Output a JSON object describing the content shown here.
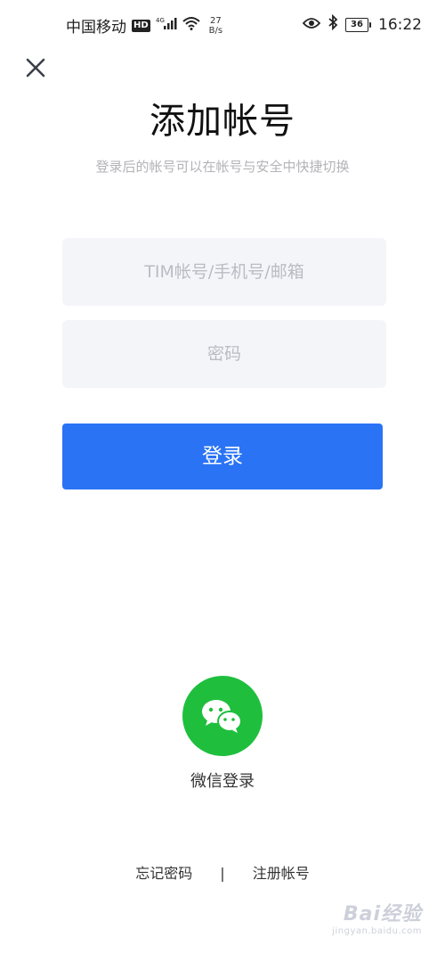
{
  "status_bar": {
    "carrier": "中国移动",
    "hd_badge": "HD",
    "network": "4G",
    "speed_value": "27",
    "speed_unit": "B/s",
    "battery": "36",
    "time": "16:22"
  },
  "header": {
    "title": "添加帐号",
    "subtitle": "登录后的帐号可以在帐号与安全中快捷切换"
  },
  "form": {
    "account_placeholder": "TIM帐号/手机号/邮箱",
    "account_value": "",
    "password_placeholder": "密码",
    "password_value": "",
    "login_label": "登录"
  },
  "social": {
    "wechat_label": "微信登录"
  },
  "footer": {
    "forgot_password": "忘记密码",
    "divider": "|",
    "register": "注册帐号"
  },
  "watermark": {
    "main": "Bai经验",
    "sub": "jingyan.baidu.com"
  },
  "colors": {
    "primary": "#2a73f5",
    "wechat": "#1fbf3d",
    "input_bg": "#f4f5f8",
    "subtitle": "#b3b3b8"
  },
  "icons": {
    "close": "close-icon",
    "wechat": "wechat-icon",
    "eye": "eye-icon",
    "bluetooth": "bluetooth-icon",
    "wifi": "wifi-icon",
    "signal": "signal-icon",
    "battery": "battery-icon"
  }
}
